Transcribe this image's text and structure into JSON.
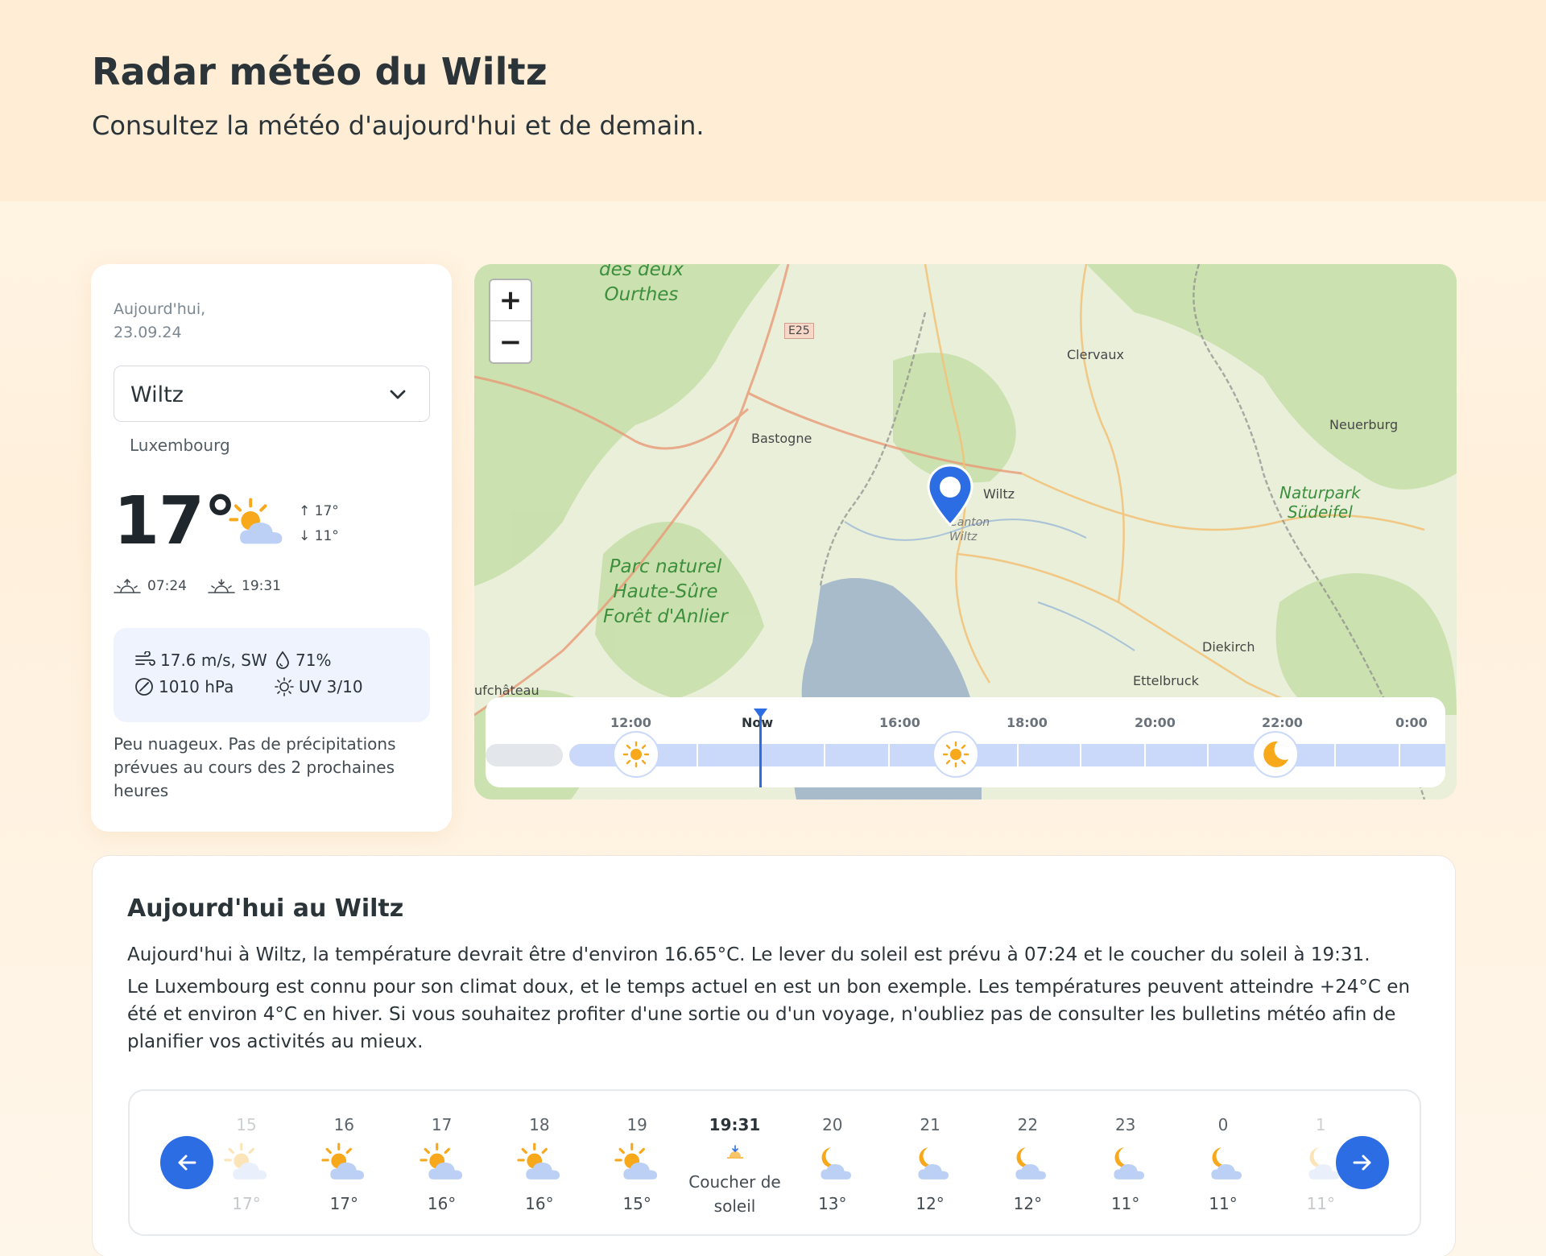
{
  "header": {
    "title": "Radar météo du Wiltz",
    "subtitle": "Consultez la météo d'aujourd'hui et de demain."
  },
  "card": {
    "date_line1": "Aujourd'hui,",
    "date_line2": "23.09.24",
    "city": "Wiltz",
    "country": "Luxembourg",
    "temperature": "17°",
    "high": "17°",
    "low": "11°",
    "sunrise": "07:24",
    "sunset": "19:31",
    "wind": "17.6 m/s, SW",
    "humidity": "71%",
    "pressure": "1010 hPa",
    "uv": "UV 3/10",
    "description": "Peu nuageux. Pas de précipitations prévues au cours des 2 prochaines heures",
    "weather_icon": "partly-cloudy-day-icon"
  },
  "map": {
    "zoom_in": "+",
    "zoom_out": "−",
    "labels": {
      "ourthes_1": "des deux",
      "ourthes_2": "Ourthes",
      "e25": "E25",
      "clervaux": "Clervaux",
      "bastogne": "Bastogne",
      "neuerburg": "Neuerburg",
      "wiltz": "Wiltz",
      "canton_1": "Canton",
      "canton_2": "Wiltz",
      "naturpark_1": "Naturpark",
      "naturpark_2": "Südeifel",
      "parc_1": "Parc naturel",
      "parc_2": "Haute-Sûre",
      "parc_3": "Forêt d'Anlier",
      "diekirch": "Diekirch",
      "ettelbruck": "Ettelbruck",
      "neufchateau": "ufchâteau"
    },
    "timeline": {
      "labels": [
        "12:00",
        "Now",
        "16:00",
        "18:00",
        "20:00",
        "22:00",
        "0:00"
      ]
    }
  },
  "today": {
    "title": "Aujourd'hui au Wiltz",
    "para1": "Aujourd'hui à Wiltz, la température devrait être d'environ 16.65°C. Le lever du soleil est prévu à 07:24 et le coucher du soleil à 19:31.",
    "para2": "Le Luxembourg est connu pour son climat doux, et le temps actuel en est un bon exemple. Les températures peuvent atteindre +24°C en été et environ 4°C en hiver. Si vous souhaitez profiter d'une sortie ou d'un voyage, n'oubliez pas de consulter les bulletins météo afin de planifier vos activités au mieux.",
    "hours": [
      {
        "h": "15",
        "t": "17°",
        "icon": "partly-cloudy-day-icon"
      },
      {
        "h": "16",
        "t": "17°",
        "icon": "partly-cloudy-day-icon"
      },
      {
        "h": "17",
        "t": "16°",
        "icon": "partly-cloudy-day-icon"
      },
      {
        "h": "18",
        "t": "16°",
        "icon": "partly-cloudy-day-icon"
      },
      {
        "h": "19",
        "t": "15°",
        "icon": "partly-cloudy-day-icon"
      },
      {
        "h": "19:31",
        "label": "Coucher de soleil",
        "icon": "sunset-icon"
      },
      {
        "h": "20",
        "t": "13°",
        "icon": "partly-cloudy-night-icon"
      },
      {
        "h": "21",
        "t": "12°",
        "icon": "partly-cloudy-night-icon"
      },
      {
        "h": "22",
        "t": "12°",
        "icon": "partly-cloudy-night-icon"
      },
      {
        "h": "23",
        "t": "11°",
        "icon": "partly-cloudy-night-icon"
      },
      {
        "h": "0",
        "t": "11°",
        "icon": "partly-cloudy-night-icon"
      },
      {
        "h": "1",
        "t": "11°",
        "icon": "partly-cloudy-night-icon"
      }
    ]
  },
  "colors": {
    "accent": "#2d6de4",
    "header_bg": "#ffeed5",
    "stats_bg": "#eef3fd",
    "sun": "#f7a81b"
  }
}
